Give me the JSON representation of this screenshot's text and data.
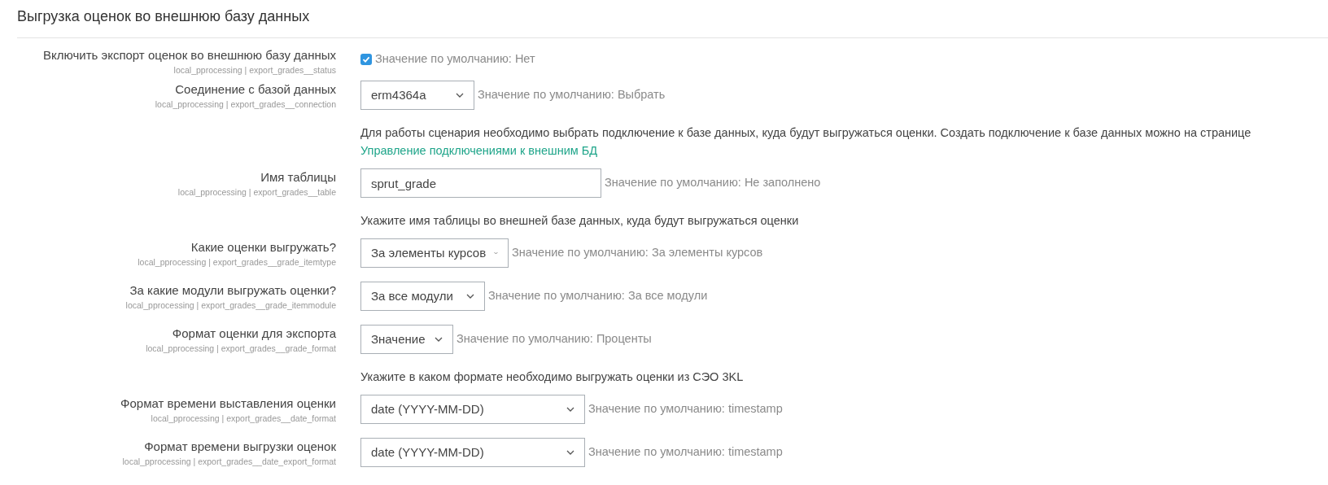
{
  "heading": "Выгрузка оценок во внешнюю базу данных",
  "settings": [
    {
      "kind": "checkbox",
      "label": "Включить экспорт оценок во внешнюю базу данных",
      "key": "local_pprocessing | export_grades__status",
      "checked": true,
      "default": "Значение по умолчанию: Нет"
    },
    {
      "kind": "select",
      "label": "Соединение с базой данных",
      "key": "local_pprocessing | export_grades__connection",
      "value": "erm4364a",
      "default": "Значение по умолчанию: Выбрать",
      "description": "Для работы сценария необходимо выбрать подключение к базе данных, куда будут выгружаться оценки. Создать подключение к базе данных можно на странице",
      "link": "Управление подключениями к внешним БД"
    },
    {
      "kind": "text",
      "label": "Имя таблицы",
      "key": "local_pprocessing | export_grades__table",
      "value": "sprut_grade",
      "default": "Значение по умолчанию: Не заполнено",
      "description": "Укажите имя таблицы во внешней базе данных, куда будут выгружаться оценки"
    },
    {
      "kind": "select",
      "label": "Какие оценки выгружать?",
      "key": "local_pprocessing | export_grades__grade_itemtype",
      "value": "За элементы курсов",
      "default": "Значение по умолчанию: За элементы курсов"
    },
    {
      "kind": "select",
      "label": "За какие модули выгружать оценки?",
      "key": "local_pprocessing | export_grades__grade_itemmodule",
      "value": "За все модули",
      "default": "Значение по умолчанию: За все модули"
    },
    {
      "kind": "select",
      "label": "Формат оценки для экспорта",
      "key": "local_pprocessing | export_grades__grade_format",
      "value": "Значение",
      "default": "Значение по умолчанию: Проценты",
      "description": "Укажите в каком формате необходимо выгружать оценки из СЭО 3KL"
    },
    {
      "kind": "select",
      "label": "Формат времени выставления оценки",
      "key": "local_pprocessing | export_grades__date_format",
      "value": "date (YYYY-MM-DD)",
      "default": "Значение по умолчанию: timestamp"
    },
    {
      "kind": "select",
      "label": "Формат времени выгрузки оценок",
      "key": "local_pprocessing | export_grades__date_export_format",
      "value": "date (YYYY-MM-DD)",
      "default": "Значение по умолчанию: timestamp"
    }
  ]
}
